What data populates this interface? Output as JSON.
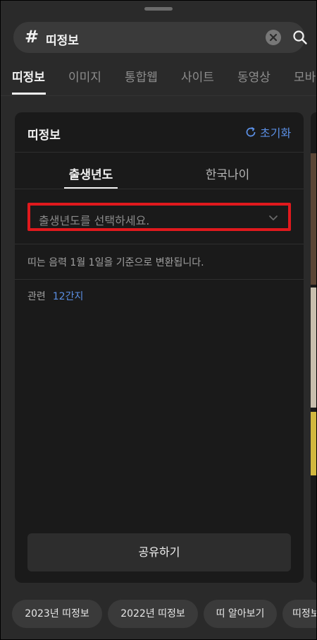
{
  "search": {
    "hash": "#",
    "query": "띠정보"
  },
  "tabs": [
    "띠정보",
    "이미지",
    "통합웹",
    "사이트",
    "동영상",
    "모바일"
  ],
  "card": {
    "title": "띠정보",
    "reset_label": "초기화",
    "subtabs": [
      "출생년도",
      "한국나이"
    ],
    "select_placeholder": "출생년도를 선택하세요.",
    "note": "띠는 음력 1월 1일을 기준으로 변환됩니다.",
    "related_label": "관련",
    "related_link": "12간지",
    "share_label": "공유하기"
  },
  "chips": [
    "2023년 띠정보",
    "2022년 띠정보",
    "띠 알아보기",
    "띠정보"
  ],
  "colors": {
    "accent": "#5b8fe4",
    "highlight_border": "#e0191d",
    "card_bg": "#1a1a1a"
  }
}
